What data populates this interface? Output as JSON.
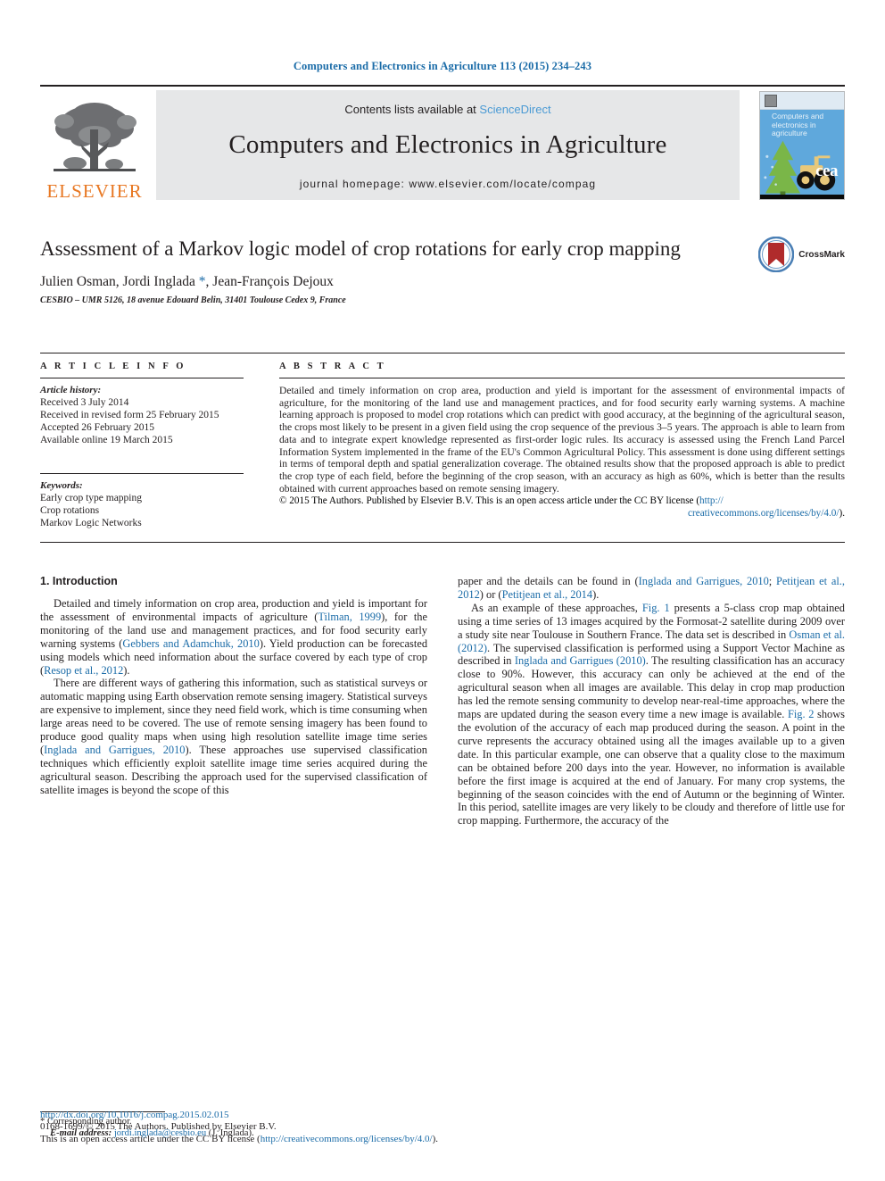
{
  "running_head": "Computers and Electronics in Agriculture 113 (2015) 234–243",
  "masthead": {
    "contents_prefix": "Contents lists available at ",
    "sciencedirect": "ScienceDirect",
    "journal_name": "Computers and Electronics in Agriculture",
    "homepage": "journal homepage: www.elsevier.com/locate/compag",
    "publisher_logo_text": "ELSEVIER",
    "cover_title": "Computers and electronics in agriculture",
    "cover_mark": "cea"
  },
  "title_block": {
    "title": "Assessment of a Markov logic model of crop rotations for early crop mapping",
    "authors_before_star": "Julien Osman, Jordi Inglada ",
    "author_star": "*",
    "authors_after_star": ", Jean-François Dejoux",
    "affiliation": "CESBIO – UMR 5126, 18 avenue Edouard Belin, 31401 Toulouse Cedex 9, France",
    "crossmark_label": "CrossMark"
  },
  "article_info": {
    "heading": "A R T I C L E  I N F O",
    "history_label": "Article history:",
    "history": [
      "Received 3 July 2014",
      "Received in revised form 25 February 2015",
      "Accepted 26 February 2015",
      "Available online 19 March 2015"
    ],
    "keywords_label": "Keywords:",
    "keywords": [
      "Early crop type mapping",
      "Crop rotations",
      "Markov Logic Networks"
    ]
  },
  "abstract": {
    "heading": "A B S T R A C T",
    "text": "Detailed and timely information on crop area, production and yield is important for the assessment of environmental impacts of agriculture, for the monitoring of the land use and management practices, and for food security early warning systems. A machine learning approach is proposed to model crop rotations which can predict with good accuracy, at the beginning of the agricultural season, the crops most likely to be present in a given field using the crop sequence of the previous 3–5 years. The approach is able to learn from data and to integrate expert knowledge represented as first-order logic rules. Its accuracy is assessed using the French Land Parcel Information System implemented in the frame of the EU's Common Agricultural Policy. This assessment is done using different settings in terms of temporal depth and spatial generalization coverage. The obtained results show that the proposed approach is able to predict the crop type of each field, before the beginning of the crop season, with an accuracy as high as 60%, which is better than the results obtained with current approaches based on remote sensing imagery.",
    "copyright_main": "© 2015 The Authors. Published by Elsevier B.V. This is an open access article under the CC BY license (",
    "copyright_link_1": "http://",
    "copyright_link_2": "creativecommons.org/licenses/by/4.0/",
    "copyright_tail": ")."
  },
  "body": {
    "section_title": "1. Introduction",
    "left_paragraphs": [
      "Detailed and timely information on crop area, production and yield is important for the assessment of environmental impacts of agriculture (Tilman, 1999), for the monitoring of the land use and management practices, and for food security early warning systems (Gebbers and Adamchuk, 2010). Yield production can be forecasted using models which need information about the surface covered by each type of crop (Resop et al., 2012).",
      "There are different ways of gathering this information, such as statistical surveys or automatic mapping using Earth observation remote sensing imagery. Statistical surveys are expensive to implement, since they need field work, which is time consuming when large areas need to be covered. The use of remote sensing imagery has been found to produce good quality maps when using high resolution satellite image time series (Inglada and Garrigues, 2010). These approaches use supervised classification techniques which efficiently exploit satellite image time series acquired during the agricultural season. Describing the approach used for the supervised classification of satellite images is beyond the scope of this"
    ],
    "right_paragraphs": [
      "paper and the details can be found in (Inglada and Garrigues, 2010; Petitjean et al., 2012) or (Petitjean et al., 2014).",
      "As an example of these approaches, Fig. 1 presents a 5-class crop map obtained using a time series of 13 images acquired by the Formosat-2 satellite during 2009 over a study site near Toulouse in Southern France. The data set is described in Osman et al. (2012). The supervised classification is performed using a Support Vector Machine as described in Inglada and Garrigues (2010). The resulting classification has an accuracy close to 90%. However, this accuracy can only be achieved at the end of the agricultural season when all images are available. This delay in crop map production has led the remote sensing community to develop near-real-time approaches, where the maps are updated during the season every time a new image is available. Fig. 2 shows the evolution of the accuracy of each map produced during the season. A point in the curve represents the accuracy obtained using all the images available up to a given date. In this particular example, one can observe that a quality close to the maximum can be obtained before 200 days into the year. However, no information is available before the first image is acquired at the end of January. For many crop systems, the beginning of the season coincides with the end of Autumn or the beginning of Winter. In this period, satellite images are very likely to be cloudy and therefore of little use for crop mapping. Furthermore, the accuracy of the"
    ],
    "citation_links": [
      "Tilman, 1999",
      "Gebbers and Adamchuk, 2010",
      "Resop et al., 2012",
      "Inglada and Garrigues, 2010",
      "Petitjean et al., 2012",
      "Petitjean et al., 2014",
      "Fig. 1",
      "Osman et al. (2012)",
      "Inglada and Garrigues (2010)",
      "Fig. 2"
    ]
  },
  "footnote": {
    "corresponding_marker": "*",
    "corresponding_text": " Corresponding author.",
    "email_label": "E-mail address:",
    "email": "jordi.inglada@cesbio.eu",
    "email_owner": "(J. Inglada)."
  },
  "footer": {
    "doi": "http://dx.doi.org/10.1016/j.compag.2015.02.015",
    "issn_line": "0168-1699/© 2015 The Authors. Published by Elsevier B.V.",
    "license_prefix": "This is an open access article under the CC BY license (",
    "license_link": "http://creativecommons.org/licenses/by/4.0/",
    "license_suffix": ")."
  },
  "colors": {
    "link": "#1b6ca8",
    "elsevier_orange": "#e87722",
    "band_gray": "#e6e7e8",
    "cover_blue": "#5fa8dc",
    "crossmark_red": "#b02b2c"
  }
}
